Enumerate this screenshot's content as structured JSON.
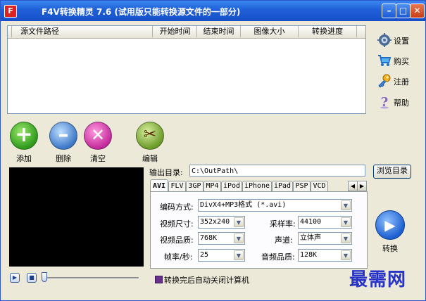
{
  "window": {
    "title": "F4V转换精灵 7.6 (试用版只能转换源文件的一部分)",
    "app_icon_letter": "F"
  },
  "file_list": {
    "columns": [
      "源文件路径",
      "开始时间",
      "结束时间",
      "图像大小",
      "转换进度"
    ]
  },
  "sidebar": {
    "items": [
      {
        "label": "设置",
        "icon": "gear-icon"
      },
      {
        "label": "购买",
        "icon": "cart-icon"
      },
      {
        "label": "注册",
        "icon": "key-icon"
      },
      {
        "label": "帮助",
        "icon": "help-icon"
      }
    ]
  },
  "toolbar": {
    "add_label": "添加",
    "delete_label": "删除",
    "clear_label": "清空",
    "edit_label": "编辑"
  },
  "output": {
    "label": "输出目录:",
    "path": "C:\\OutPath\\",
    "browse_label": "浏览目录"
  },
  "format_tabs": [
    "AVI",
    "FLV",
    "3GP",
    "MP4",
    "iPod",
    "iPhone",
    "iPad",
    "PSP",
    "VCD"
  ],
  "settings": {
    "encoder_label": "编码方式:",
    "encoder_value": "DivX4+MP3格式 (*.avi)",
    "size_label": "视频尺寸:",
    "size_value": "352x240",
    "samplerate_label": "采样率:",
    "samplerate_value": "44100",
    "quality_label": "视频品质:",
    "quality_value": "768K",
    "channels_label": "声道:",
    "channels_value": "立体声",
    "fps_label": "帧率/秒:",
    "fps_value": "25",
    "audio_quality_label": "音频品质:",
    "audio_quality_value": "128K"
  },
  "convert": {
    "label": "转换"
  },
  "footer": {
    "shutdown_label": "转换完后自动关闭计算机"
  },
  "watermark": "最需网",
  "colors": {
    "accent": "#1f5fd8",
    "watermark": "#2733c8"
  }
}
